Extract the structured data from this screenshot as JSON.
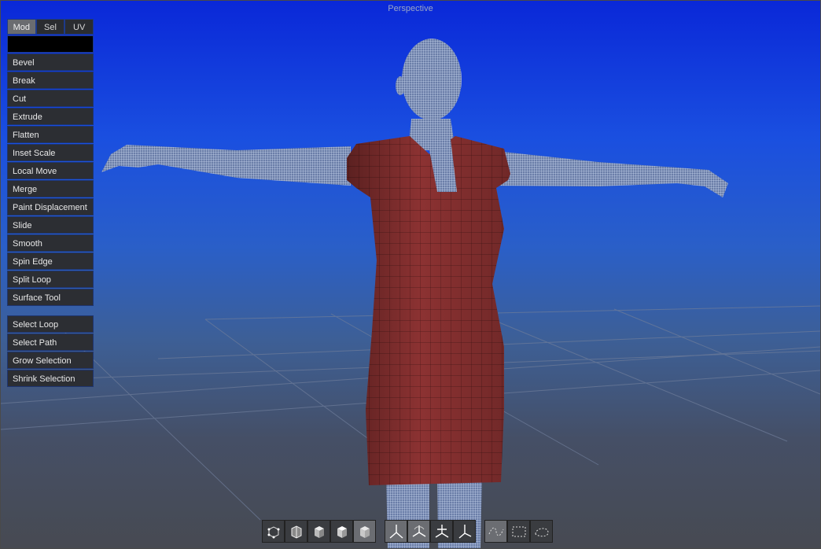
{
  "viewport": {
    "title": "Perspective"
  },
  "panel": {
    "tabs": [
      {
        "label": "Mod",
        "active": true
      },
      {
        "label": "Sel",
        "active": false
      },
      {
        "label": "UV",
        "active": false
      }
    ],
    "tools": [
      "Bevel",
      "Break",
      "Cut",
      "Extrude",
      "Flatten",
      "Inset Scale",
      "Local Move",
      "Merge",
      "Paint Displacement",
      "Slide",
      "Smooth",
      "Spin Edge",
      "Split Loop",
      "Surface Tool"
    ],
    "selection_tools": [
      "Select Loop",
      "Select Path",
      "Grow Selection",
      "Shrink Selection"
    ]
  },
  "toolbar": {
    "display_modes": [
      {
        "icon": "vertex-mode-icon"
      },
      {
        "icon": "wireframe-shaded-icon"
      },
      {
        "icon": "solid-shaded-icon"
      },
      {
        "icon": "textured-shaded-icon"
      },
      {
        "icon": "smooth-shaded-icon",
        "active": true
      }
    ],
    "transform_modes": [
      {
        "icon": "transform-axis-icon",
        "active": true
      },
      {
        "icon": "rotate-axis-icon",
        "active": true
      },
      {
        "icon": "scale-axis-icon"
      },
      {
        "icon": "local-axis-icon"
      }
    ],
    "select_modes": [
      {
        "icon": "lasso-select-icon",
        "active": true
      },
      {
        "icon": "rect-select-icon"
      },
      {
        "icon": "freehand-select-icon"
      }
    ]
  },
  "colors": {
    "dress": "#8c3232",
    "wire": "#9fb4e0",
    "button_bg": "#2c2e33",
    "accent_border": "#1e3570"
  }
}
